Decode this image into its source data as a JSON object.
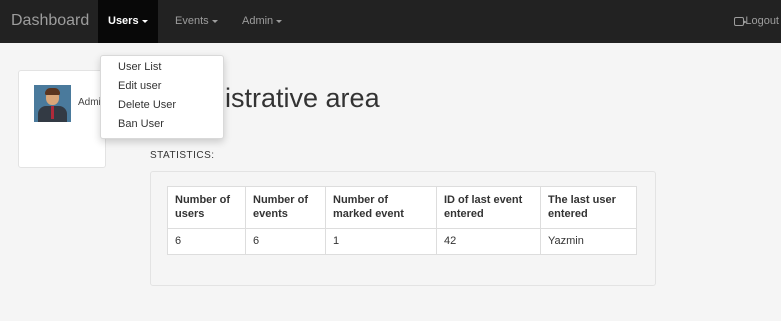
{
  "navbar": {
    "brand": "Dashboard",
    "items": [
      {
        "label": "Users",
        "active": true
      },
      {
        "label": "Events",
        "active": false
      },
      {
        "label": "Admin",
        "active": false
      }
    ],
    "logout_label": "Logout",
    "logout_icon": "logout-icon"
  },
  "users_menu": {
    "items": [
      "User List",
      "Edit user",
      "Delete User",
      "Ban User"
    ]
  },
  "profile": {
    "name": "Admi",
    "avatar_icon": "user-avatar"
  },
  "main": {
    "title": "Administrative area",
    "visible_title": "nistrative area",
    "stats_label": "STATISTICS:"
  },
  "stats_table": {
    "headers": [
      "Number of users",
      "Number of events",
      "Number of marked event",
      "ID of last event entered",
      "The last user entered"
    ],
    "rows": [
      [
        "6",
        "6",
        "1",
        "42",
        "Yazmin"
      ]
    ]
  },
  "colors": {
    "navbar_bg": "#222222",
    "navbar_active_bg": "#080808",
    "page_bg": "#f5f5f5"
  }
}
